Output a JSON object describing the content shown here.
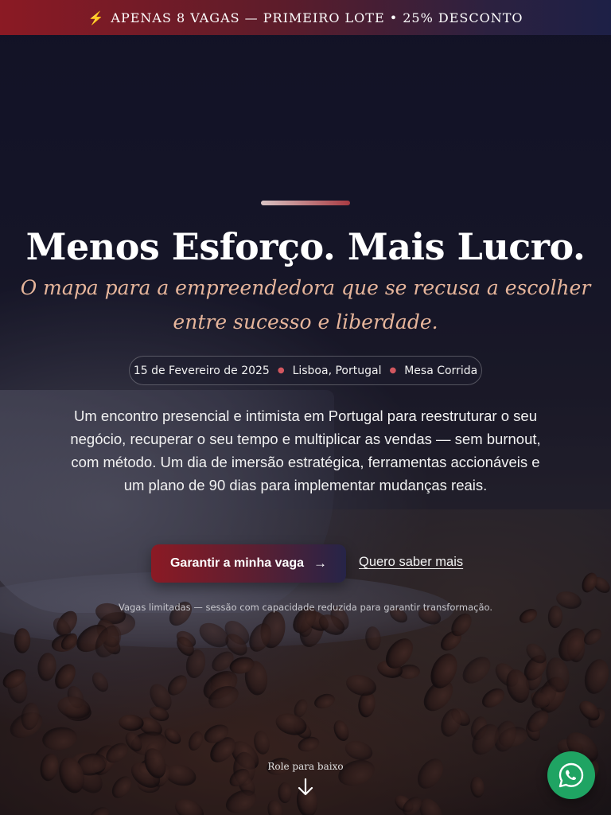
{
  "banner": {
    "icon": "lightning-icon",
    "text": "APENAS 8 VAGAS — PRIMEIRO LOTE • 25% DESCONTO"
  },
  "hero": {
    "title": "Menos Esforço. Mais Lucro.",
    "subtitle": "O mapa para a empreendedora que se recusa a escolher entre sucesso e liberdade.",
    "event_details": {
      "date": "15 de Fevereiro de 2025",
      "location": "Lisboa, Portugal",
      "format": "Mesa Corrida"
    },
    "description": "Um encontro presencial e intimista em Portugal para reestruturar o seu negócio, recuperar o seu tempo e multiplicar as vendas — sem burnout, com método. Um dia de imersão estratégica, ferramentas accionáveis e um plano de 90 dias para implementar mudanças reais.",
    "cta_primary": "Garantir a minha vaga",
    "cta_secondary": "Quero saber mais",
    "note": "Vagas limitadas — sessão com capacidade reduzida para garantir transformação.",
    "scroll_label": "Role para baixo"
  },
  "floating": {
    "whatsapp_icon": "whatsapp-icon"
  },
  "colors": {
    "brand_red": "#8b1a24",
    "brand_navy": "#1d2046",
    "subtitle_peach": "#e6b59b",
    "whatsapp_green": "#1fa463"
  }
}
